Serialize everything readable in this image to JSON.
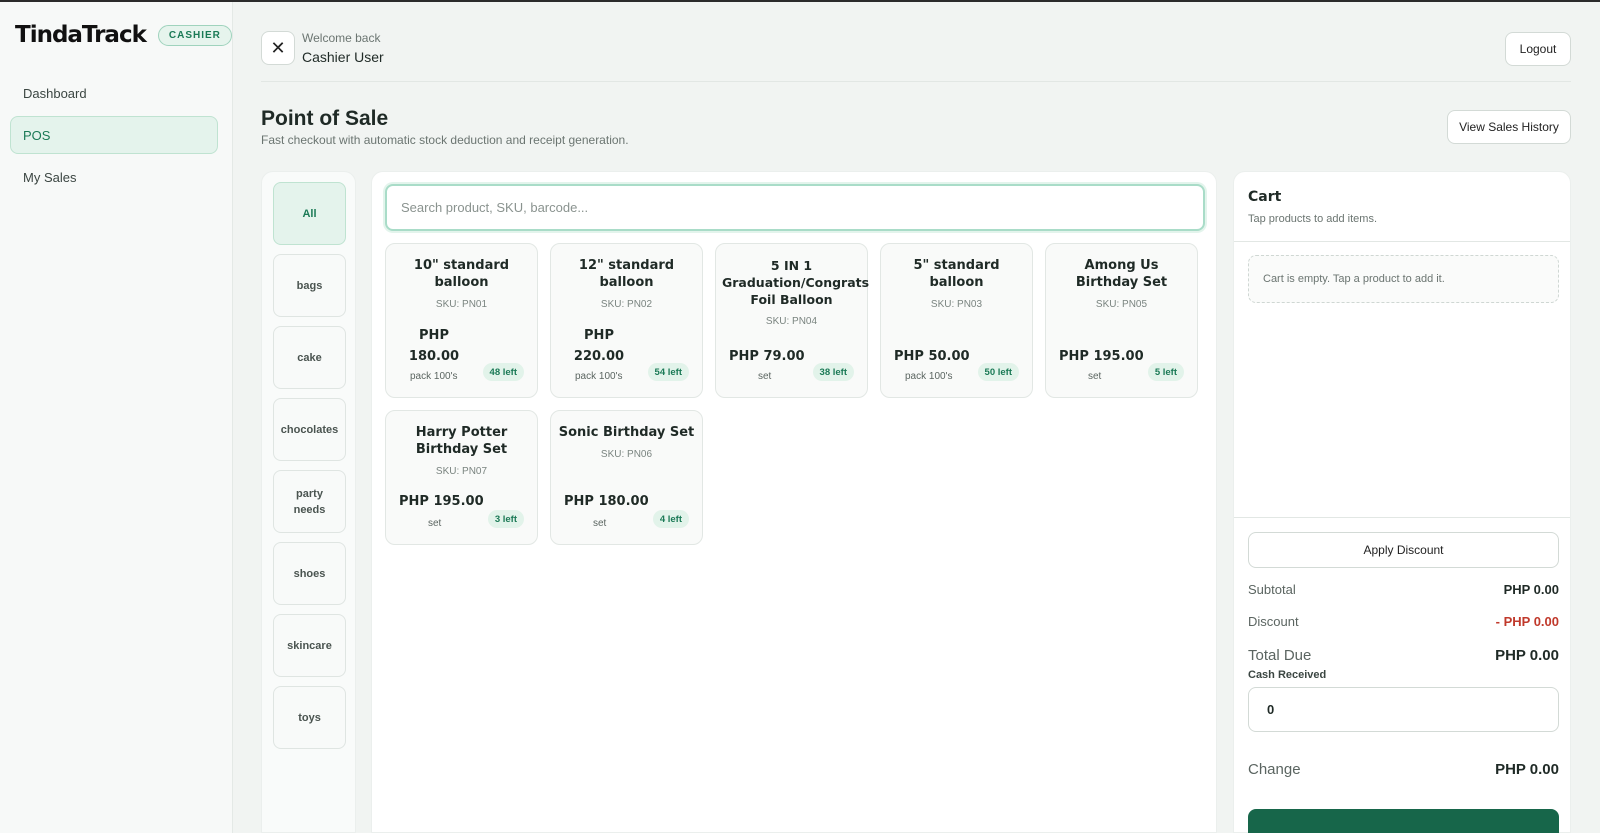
{
  "brand": {
    "name": "TindaTrack",
    "role_badge": "CASHIER"
  },
  "sidebar": {
    "items": [
      {
        "label": "Dashboard"
      },
      {
        "label": "POS"
      },
      {
        "label": "My Sales"
      }
    ]
  },
  "header": {
    "welcome": "Welcome back",
    "user": "Cashier User",
    "logout_label": "Logout"
  },
  "page": {
    "title": "Point of Sale",
    "subtitle": "Fast checkout with automatic stock deduction and receipt generation.",
    "history_label": "View Sales History"
  },
  "categories": [
    "All",
    "bags",
    "cake",
    "chocolates",
    "party needs",
    "shoes",
    "skincare",
    "toys"
  ],
  "search": {
    "placeholder": "Search product, SKU, barcode..."
  },
  "products": [
    {
      "name": "10\" standard balloon",
      "sku": "SKU: PN01",
      "price": "PHP 180.00",
      "unit": "pack 100's",
      "stock": "48 left"
    },
    {
      "name": "12\" standard balloon",
      "sku": "SKU: PN02",
      "price": "PHP 220.00",
      "unit": "pack 100's",
      "stock": "54 left"
    },
    {
      "name": "5 IN 1 Graduation/Congrats Foil Balloon",
      "sku": "SKU: PN04",
      "price": "PHP 79.00",
      "unit": "set",
      "stock": "38 left"
    },
    {
      "name": "5\" standard balloon",
      "sku": "SKU: PN03",
      "price": "PHP 50.00",
      "unit": "pack 100's",
      "stock": "50 left"
    },
    {
      "name": "Among Us Birthday Set",
      "sku": "SKU: PN05",
      "price": "PHP 195.00",
      "unit": "set",
      "stock": "5 left"
    },
    {
      "name": "Harry Potter Birthday Set",
      "sku": "SKU: PN07",
      "price": "PHP 195.00",
      "unit": "set",
      "stock": "3 left"
    },
    {
      "name": "Sonic Birthday Set",
      "sku": "SKU: PN06",
      "price": "PHP 180.00",
      "unit": "set",
      "stock": "4 left"
    }
  ],
  "cart": {
    "title": "Cart",
    "subtitle": "Tap products to add items.",
    "empty_text": "Cart is empty. Tap a product to add it.",
    "discount_button": "Apply Discount",
    "subtotal_label": "Subtotal",
    "subtotal_value": "PHP 0.00",
    "discount_label": "Discount",
    "discount_value": "- PHP 0.00",
    "total_label": "Total Due",
    "total_value": "PHP 0.00",
    "cash_label": "Cash Received",
    "cash_value": "0",
    "change_label": "Change",
    "change_value": "PHP 0.00"
  },
  "colors": {
    "accent": "#1b7a56",
    "accent_bg": "#e4f3ec",
    "discount": "#c0392b",
    "checkout": "#17664a"
  }
}
